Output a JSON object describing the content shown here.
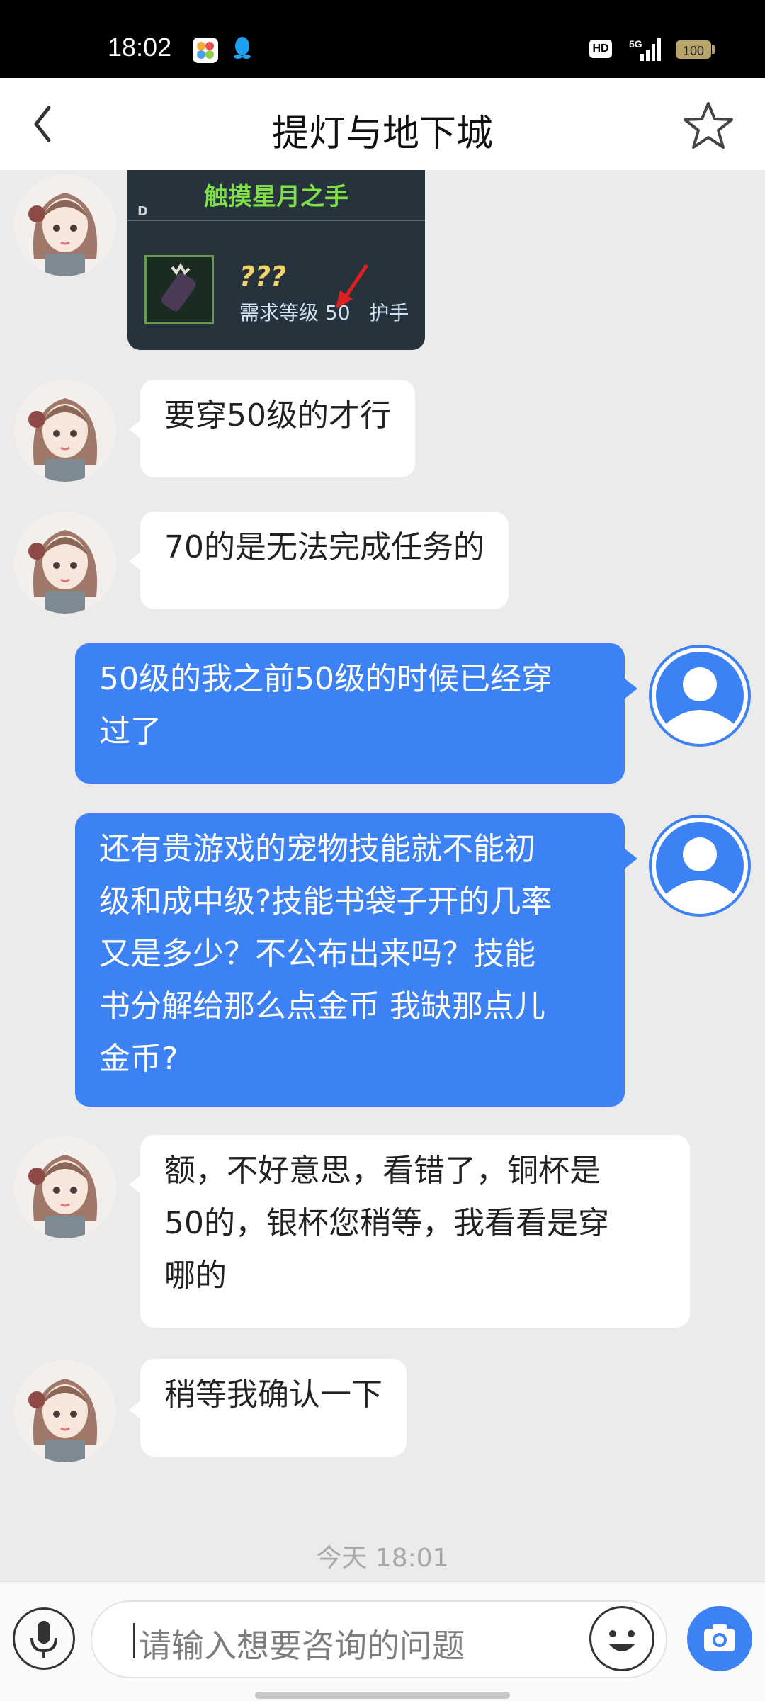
{
  "status_bar": {
    "time": "18:02",
    "network": "5G",
    "hd": "HD",
    "battery": "100",
    "app_icons": [
      "photos-app-icon",
      "qq-penguin-icon"
    ]
  },
  "header": {
    "title": "提灯与地下城",
    "back_icon": "chevron-left-icon",
    "favorite_icon": "star-outline-icon"
  },
  "chat": {
    "image_message": {
      "item_name": "触摸星月之手",
      "grade": "D",
      "unknown_stat": "???",
      "requirement": "需求等级 50",
      "slot": "护手"
    },
    "messages": [
      {
        "sender": "agent",
        "text": "要穿50级的才行"
      },
      {
        "sender": "agent",
        "text": "70的是无法完成任务的"
      },
      {
        "sender": "user",
        "text": "50级的我之前50级的时候已经穿\n过了"
      },
      {
        "sender": "user",
        "text": "还有贵游戏的宠物技能就不能初\n级和成中级?技能书袋子开的几率\n又是多少？不公布出来吗？技能\n书分解给那么点金币 我缺那点儿\n金币?"
      },
      {
        "sender": "agent",
        "text": "额，不好意思，看错了，铜杯是\n50的，银杯您稍等，我看看是穿\n哪的"
      },
      {
        "sender": "agent",
        "text": "稍等我确认一下"
      }
    ],
    "timestamp": "今天 18:01"
  },
  "input_bar": {
    "placeholder": "请输入想要咨询的问题",
    "mic_icon": "microphone-icon",
    "emoji_icon": "smiley-face-icon",
    "camera_icon": "camera-icon"
  },
  "colors": {
    "user_bubble": "#3c82f4",
    "agent_bubble": "#ffffff",
    "background": "#ebebeb",
    "item_name": "#7fe04a"
  }
}
